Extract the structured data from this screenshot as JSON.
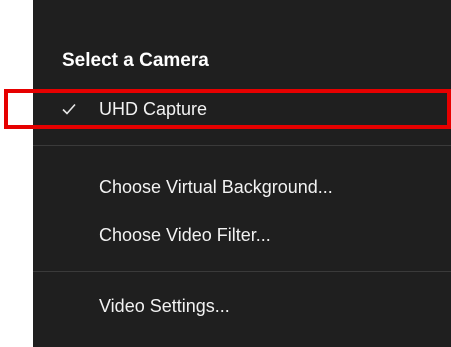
{
  "menu": {
    "section_title": "Select a Camera",
    "camera_items": [
      {
        "label": "UHD Capture",
        "selected": true
      }
    ],
    "background_items": [
      {
        "label": "Choose Virtual Background..."
      },
      {
        "label": "Choose Video Filter..."
      }
    ],
    "settings_items": [
      {
        "label": "Video Settings..."
      }
    ]
  },
  "colors": {
    "menu_background": "#1f1f1f",
    "text": "#f2f2f2",
    "divider": "#3a3a3a",
    "highlight": "#e60000"
  },
  "icons": {
    "selected_mark": "checkmark-icon"
  }
}
